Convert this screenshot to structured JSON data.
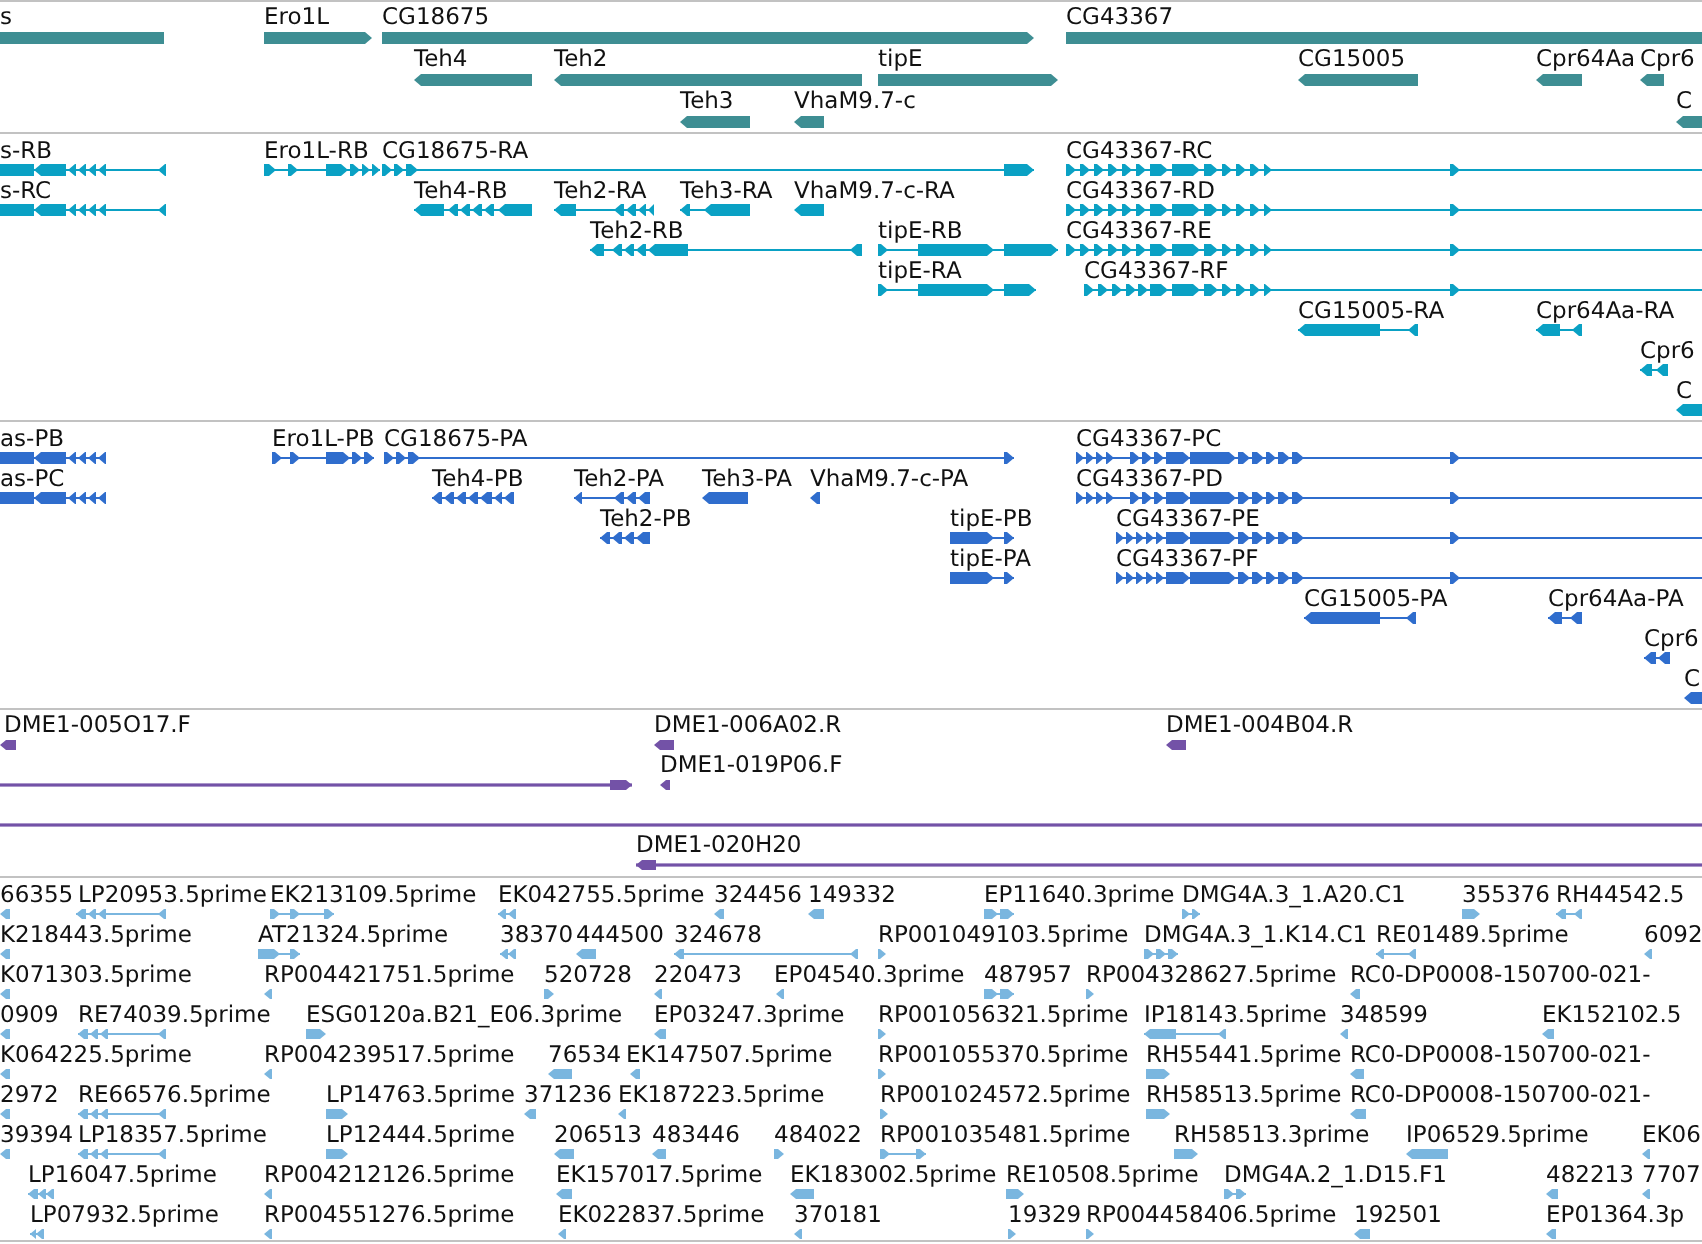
{
  "tracks": [
    {
      "kind": "gene",
      "features": [
        {
          "label": "s",
          "forward": false
        },
        {
          "label": "Ero1L",
          "forward": true
        },
        {
          "label": "CG18675",
          "forward": true
        },
        {
          "label": "CG43367",
          "forward": true
        },
        {
          "label": "Teh4",
          "forward": false
        },
        {
          "label": "Teh2",
          "forward": false
        },
        {
          "label": "tipE",
          "forward": true
        },
        {
          "label": "CG15005",
          "forward": false
        },
        {
          "label": "Cpr64Aa",
          "forward": false
        },
        {
          "label": "Cpr6",
          "forward": false
        },
        {
          "label": "Teh3",
          "forward": false
        },
        {
          "label": "VhaM9.7-c",
          "forward": false
        },
        {
          "label": "C",
          "forward": false
        }
      ]
    },
    {
      "kind": "transcript",
      "features": [
        {
          "label": "s-RB",
          "forward": false
        },
        {
          "label": "Ero1L-RB",
          "forward": true
        },
        {
          "label": "CG18675-RA",
          "forward": true
        },
        {
          "label": "CG43367-RC",
          "forward": true
        },
        {
          "label": "s-RC",
          "forward": false
        },
        {
          "label": "Teh4-RB",
          "forward": false
        },
        {
          "label": "Teh2-RA",
          "forward": false
        },
        {
          "label": "Teh3-RA",
          "forward": false
        },
        {
          "label": "VhaM9.7-c-RA",
          "forward": false
        },
        {
          "label": "CG43367-RD",
          "forward": true
        },
        {
          "label": "Teh2-RB",
          "forward": false
        },
        {
          "label": "tipE-RB",
          "forward": true
        },
        {
          "label": "CG43367-RE",
          "forward": true
        },
        {
          "label": "tipE-RA",
          "forward": true
        },
        {
          "label": "CG43367-RF",
          "forward": true
        },
        {
          "label": "CG15005-RA",
          "forward": false
        },
        {
          "label": "Cpr64Aa-RA",
          "forward": false
        },
        {
          "label": "Cpr6",
          "forward": false
        },
        {
          "label": "C",
          "forward": false
        }
      ]
    },
    {
      "kind": "protein",
      "features": [
        {
          "label": "as-PB",
          "forward": false
        },
        {
          "label": "Ero1L-PB",
          "forward": true
        },
        {
          "label": "CG18675-PA",
          "forward": true
        },
        {
          "label": "CG43367-PC",
          "forward": true
        },
        {
          "label": "as-PC",
          "forward": false
        },
        {
          "label": "Teh4-PB",
          "forward": false
        },
        {
          "label": "Teh2-PA",
          "forward": false
        },
        {
          "label": "Teh3-PA",
          "forward": false
        },
        {
          "label": "VhaM9.7-c-PA",
          "forward": false
        },
        {
          "label": "CG43367-PD",
          "forward": true
        },
        {
          "label": "Teh2-PB",
          "forward": false
        },
        {
          "label": "tipE-PB",
          "forward": true
        },
        {
          "label": "CG43367-PE",
          "forward": true
        },
        {
          "label": "tipE-PA",
          "forward": true
        },
        {
          "label": "CG43367-PF",
          "forward": true
        },
        {
          "label": "CG15005-PA",
          "forward": false
        },
        {
          "label": "Cpr64Aa-PA",
          "forward": false
        },
        {
          "label": "Cpr6",
          "forward": false
        },
        {
          "label": "C",
          "forward": false
        }
      ]
    },
    {
      "kind": "clone",
      "features": [
        {
          "label": "DME1-005O17.F",
          "kind": "end",
          "forward": false
        },
        {
          "label": "DME1-006A02.R",
          "kind": "end",
          "forward": false
        },
        {
          "label": "DME1-004B04.R",
          "kind": "end",
          "forward": false
        },
        {
          "kind": "span",
          "forward": true
        },
        {
          "label": "DME1-019P06.F",
          "kind": "end",
          "forward": false
        },
        {
          "kind": "span"
        },
        {
          "label": "DME1-020H20",
          "kind": "span",
          "forward": false
        }
      ]
    },
    {
      "kind": "est",
      "features": [
        {
          "label": "66355",
          "forward": false
        },
        {
          "label": "LP20953.5prime",
          "forward": false
        },
        {
          "label": "EK213109.5prime",
          "forward": true
        },
        {
          "label": "EK042755.5prime",
          "forward": false
        },
        {
          "label": "324456",
          "forward": false
        },
        {
          "label": "149332",
          "forward": false
        },
        {
          "label": "EP11640.3prime",
          "forward": true
        },
        {
          "label": "DMG4A.3_1.A20.C1",
          "forward": true
        },
        {
          "label": "355376",
          "forward": true
        },
        {
          "label": "RH44542.5",
          "forward": false
        },
        {
          "label": "K218443.5prime",
          "forward": false
        },
        {
          "label": "AT21324.5prime",
          "forward": true
        },
        {
          "label": "38370",
          "forward": false
        },
        {
          "label": "444500",
          "forward": false
        },
        {
          "label": "324678",
          "forward": false
        },
        {
          "label": "RP001049103.5prime",
          "forward": true
        },
        {
          "label": "DMG4A.3_1.K14.C1",
          "forward": true
        },
        {
          "label": "RE01489.5prime",
          "forward": false
        },
        {
          "label": "6092",
          "forward": false
        },
        {
          "label": "K071303.5prime",
          "forward": false
        },
        {
          "label": "RP004421751.5prime",
          "forward": false
        },
        {
          "label": "520728",
          "forward": true
        },
        {
          "label": "220473",
          "forward": false
        },
        {
          "label": "EP04540.3prime",
          "forward": false
        },
        {
          "label": "487957",
          "forward": true
        },
        {
          "label": "RP004328627.5prime",
          "forward": true
        },
        {
          "label": "RC0-DP0008-150700-021-",
          "forward": false
        },
        {
          "label": "0909",
          "forward": false
        },
        {
          "label": "RE74039.5prime",
          "forward": false
        },
        {
          "label": "ESG0120a.B21_E06.3prime",
          "forward": true
        },
        {
          "label": "EP03247.3prime",
          "forward": false
        },
        {
          "label": "RP001056321.5prime",
          "forward": true
        },
        {
          "label": "IP18143.5prime",
          "forward": false
        },
        {
          "label": "348599",
          "forward": false
        },
        {
          "label": "EK152102.5",
          "forward": false
        },
        {
          "label": "K064225.5prime",
          "forward": false
        },
        {
          "label": "RP004239517.5prime",
          "forward": false
        },
        {
          "label": "76534",
          "forward": false
        },
        {
          "label": "EK147507.5prime",
          "forward": false
        },
        {
          "label": "RP001055370.5prime",
          "forward": true
        },
        {
          "label": "RH55441.5prime",
          "forward": true
        },
        {
          "label": "RC0-DP0008-150700-021-",
          "forward": false
        },
        {
          "label": "2972",
          "forward": false
        },
        {
          "label": "RE66576.5prime",
          "forward": false
        },
        {
          "label": "LP14763.5prime",
          "forward": true
        },
        {
          "label": "371236",
          "forward": false
        },
        {
          "label": "EK187223.5prime",
          "forward": false
        },
        {
          "label": "RP001024572.5prime",
          "forward": true
        },
        {
          "label": "RH58513.5prime",
          "forward": true
        },
        {
          "label": "RC0-DP0008-150700-021-",
          "forward": false
        },
        {
          "label": "39394",
          "forward": false
        },
        {
          "label": "LP18357.5prime",
          "forward": false
        },
        {
          "label": "LP12444.5prime",
          "forward": true
        },
        {
          "label": "206513",
          "forward": false
        },
        {
          "label": "483446",
          "forward": false
        },
        {
          "label": "484022",
          "forward": true
        },
        {
          "label": "RP001035481.5prime",
          "forward": true
        },
        {
          "label": "RH58513.3prime",
          "forward": true
        },
        {
          "label": "IP06529.5prime",
          "forward": false
        },
        {
          "label": "EK06",
          "forward": false
        },
        {
          "label": "LP16047.5prime",
          "forward": false
        },
        {
          "label": "RP004212126.5prime",
          "forward": false
        },
        {
          "label": "EK157017.5prime",
          "forward": false
        },
        {
          "label": "EK183002.5prime",
          "forward": false
        },
        {
          "label": "RE10508.5prime",
          "forward": true
        },
        {
          "label": "DMG4A.2_1.D15.F1",
          "forward": true
        },
        {
          "label": "482213",
          "forward": false
        },
        {
          "label": "7707",
          "forward": false
        },
        {
          "label": "LP07932.5prime",
          "forward": false
        },
        {
          "label": "RP004551276.5prime",
          "forward": false
        },
        {
          "label": "EK022837.5prime",
          "forward": false
        },
        {
          "label": "370181",
          "forward": false
        },
        {
          "label": "19329",
          "forward": true
        },
        {
          "label": "RP004458406.5prime",
          "forward": true
        },
        {
          "label": "192501",
          "forward": false
        },
        {
          "label": "EP01364.3p",
          "forward": false
        }
      ]
    }
  ]
}
